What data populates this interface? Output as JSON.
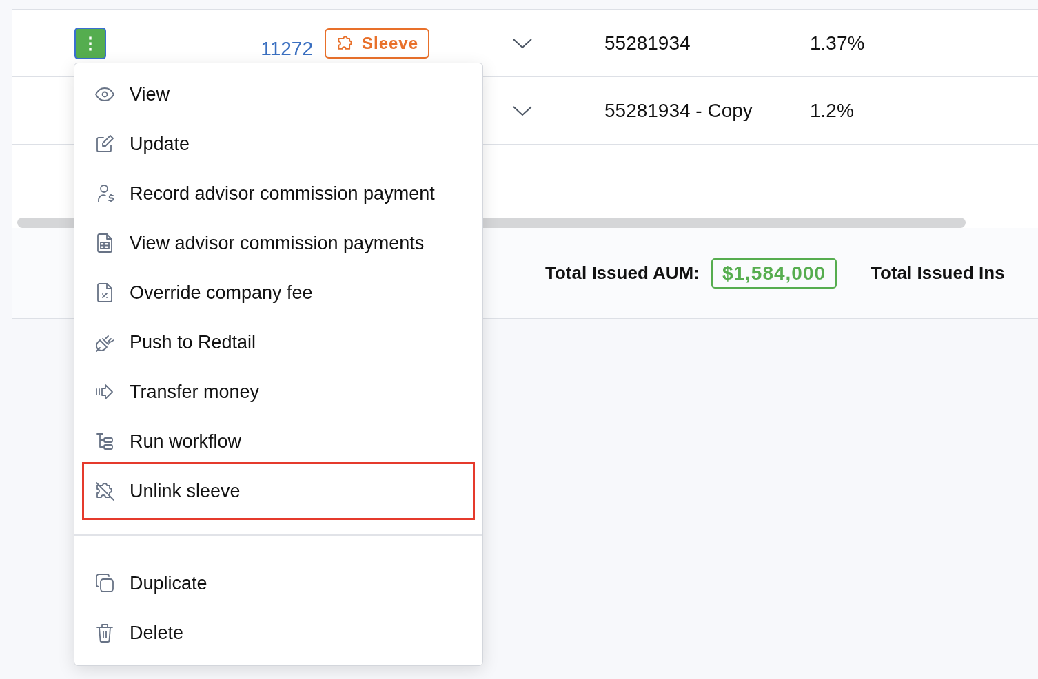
{
  "rows": [
    {
      "action_button": "⋮",
      "id": "11272",
      "badge": {
        "label": "Sleeve",
        "color": "#e8702a"
      },
      "account": "55281934",
      "rate": "1.37%"
    },
    {
      "account": "55281934 - Copy",
      "rate": "1.2%"
    }
  ],
  "totals": [
    {
      "label": "Total Issued AUM:",
      "value": "$1,584,000"
    },
    {
      "label": "Total Issued Ins"
    }
  ],
  "menu": {
    "groups": [
      [
        {
          "label": "View",
          "kind": "eye",
          "highlighted": false
        },
        {
          "label": "Update",
          "kind": "edit",
          "highlighted": false
        },
        {
          "label": "Record advisor commission payment",
          "kind": "user-dollar",
          "highlighted": false
        },
        {
          "label": "View advisor commission payments",
          "kind": "file-table",
          "highlighted": false
        },
        {
          "label": "Override company fee",
          "kind": "file-percent",
          "highlighted": false
        },
        {
          "label": "Push to Redtail",
          "kind": "plug",
          "highlighted": false
        },
        {
          "label": "Transfer money",
          "kind": "arrow",
          "highlighted": false
        },
        {
          "label": "Run workflow",
          "kind": "tree",
          "highlighted": false
        },
        {
          "label": "Unlink sleeve",
          "kind": "puzzle-off",
          "highlighted": true
        }
      ],
      [
        {
          "label": "Duplicate",
          "kind": "copy",
          "highlighted": false
        },
        {
          "label": "Delete",
          "kind": "trash",
          "highlighted": false
        }
      ]
    ]
  }
}
